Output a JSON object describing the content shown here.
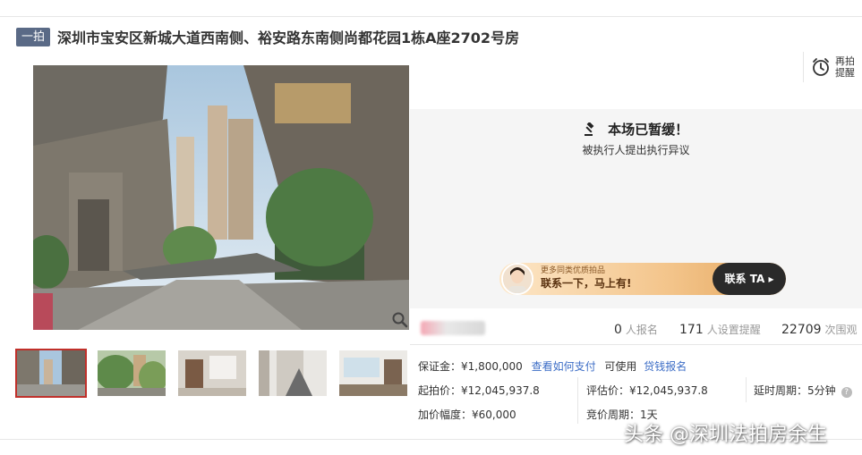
{
  "header": {
    "badge": "一拍",
    "title": "深圳市宝安区新城大道西南侧、裕安路东南侧尚都花园1栋A座2702号房"
  },
  "remind": {
    "label": "再拍提醒",
    "icon": "alarm-clock-icon"
  },
  "status": {
    "headline": "本场已暂缓！",
    "subtext": "被执行人提出执行异议",
    "icon": "gavel-icon"
  },
  "contact": {
    "small": "更多同类优质拍品",
    "big": "联系一下，马上有!",
    "button": "联系 TA"
  },
  "stats": {
    "signups": "0",
    "signups_label": "人报名",
    "reminders": "171",
    "reminders_label": "人设置提醒",
    "views": "22709",
    "views_label": "次围观"
  },
  "details": {
    "deposit_label": "保证金：",
    "deposit_value": "¥1,800,000",
    "deposit_link": "查看如何支付",
    "usable_label": "可使用",
    "usable_link": "贷钱报名",
    "start_label": "起拍价：",
    "start_value": "¥12,045,937.8",
    "appraisal_label": "评估价：",
    "appraisal_value": "¥12,045,937.8",
    "delay_label": "延时周期：",
    "delay_value": "5分钟",
    "increment_label": "加价幅度：",
    "increment_value": "¥60,000",
    "bid_cycle_label": "竞价周期：",
    "bid_cycle_value": "1天"
  },
  "watermark": "头条 @深圳法拍房余生",
  "colors": {
    "badge": "#5a6a86",
    "link": "#3c6dc6",
    "thumb_active": "#c0302a"
  }
}
